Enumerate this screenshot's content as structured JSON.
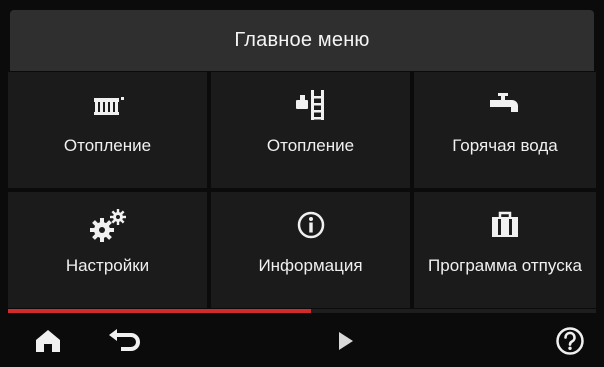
{
  "header": {
    "title": "Главное меню"
  },
  "tiles": [
    {
      "label": "Отопление",
      "icon": "radiator-icon"
    },
    {
      "label": "Отопление",
      "icon": "floor-heating-icon"
    },
    {
      "label": "Горячая вода",
      "icon": "faucet-icon"
    },
    {
      "label": "Настройки",
      "icon": "gears-icon"
    },
    {
      "label": "Информация",
      "icon": "info-icon"
    },
    {
      "label": "Программа отпуска",
      "icon": "suitcase-icon"
    }
  ],
  "progress": {
    "fraction": 0.515,
    "color": "#d22b2b"
  },
  "footer": {
    "buttons": [
      {
        "icon": "home-icon"
      },
      {
        "icon": "back-arrow-icon"
      },
      {
        "icon": "play-next-icon"
      },
      {
        "icon": "help-icon"
      }
    ]
  }
}
